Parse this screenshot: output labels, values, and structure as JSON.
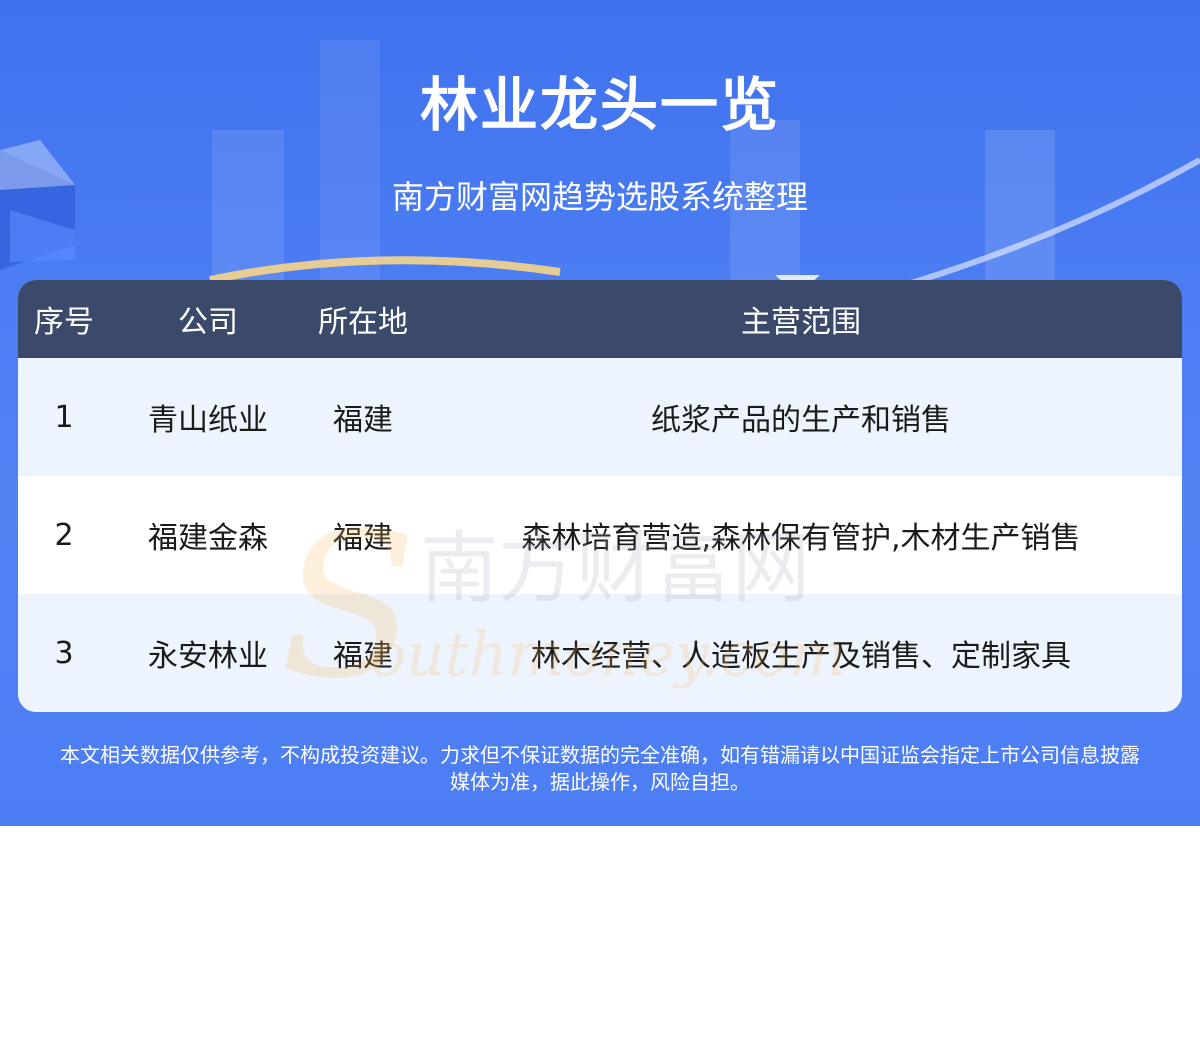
{
  "header": {
    "title": "林业龙头一览",
    "subtitle": "南方财富网趋势选股系统整理"
  },
  "table": {
    "columns": [
      "序号",
      "公司",
      "所在地",
      "主营范围"
    ],
    "rows": [
      {
        "index": "1",
        "company": "青山纸业",
        "location": "福建",
        "business": "纸浆产品的生产和销售"
      },
      {
        "index": "2",
        "company": "福建金森",
        "location": "福建",
        "business": "森林培育营造,森林保有管护,木材生产销售"
      },
      {
        "index": "3",
        "company": "永安林业",
        "location": "福建",
        "business": "林木经营、人造板生产及销售、定制家具"
      }
    ]
  },
  "watermark": {
    "cn": "南方财富网",
    "en": "outhmoney.com",
    "letter": "S"
  },
  "footer": {
    "disclaimer_line1": "本文相关数据仅供参考，不构成投资建议。力求但不保证数据的完全准确，如有错漏请以中国证监会指定上市公司信息披露",
    "disclaimer_line2": "媒体为准，据此操作，风险自担。"
  },
  "colors": {
    "background_blue": "#4a7bf2",
    "header_row": "#3b4a6b",
    "row_stripe": "#eef4fd",
    "watermark_orange": "#f4b860"
  }
}
